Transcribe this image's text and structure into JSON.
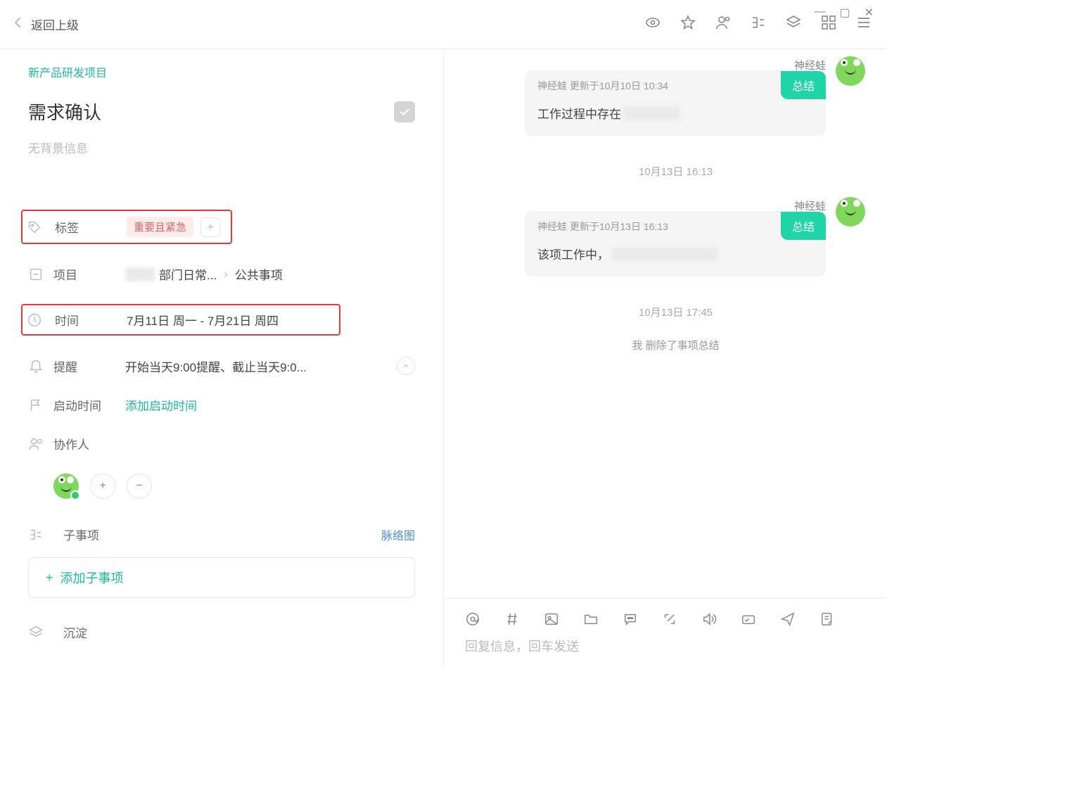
{
  "window": {
    "minimize": "—",
    "maximize": "▢",
    "close": "✕"
  },
  "topbar": {
    "back_label": "返回上级"
  },
  "breadcrumb": "新产品研发项目",
  "title": "需求确认",
  "subtitle_placeholder": "无背景信息",
  "fields": {
    "tags": {
      "label": "标签",
      "tag": "重要且紧急"
    },
    "project": {
      "label": "项目",
      "value_suffix": "部门日常...",
      "crumb": "公共事项"
    },
    "time": {
      "label": "时间",
      "value": "7月11日 周一 - 7月21日 周四"
    },
    "reminder": {
      "label": "提醒",
      "value": "开始当天9:00提醒、截止当天9:0..."
    },
    "start_time": {
      "label": "启动时间",
      "action": "添加启动时间"
    },
    "collaborators": {
      "label": "协作人"
    },
    "subitems": {
      "label": "子事项",
      "context_link": "脉络图",
      "add_label": "添加子事项"
    },
    "precipitate": {
      "label": "沉淀"
    }
  },
  "chat": {
    "messages": [
      {
        "sender": "神经蛙",
        "meta": "神经蛙 更新于10月10日 10:34",
        "tag": "总结",
        "body_prefix": "工作过程中存在"
      }
    ],
    "ts1": "10月13日 16:13",
    "messages2": [
      {
        "sender": "神经蛙",
        "meta": "神经蛙 更新于10月13日 16:13",
        "tag": "总结",
        "body_prefix": "该项工作中，"
      }
    ],
    "ts2": "10月13日 17:45",
    "sys_msg": "我 删除了事项总结"
  },
  "compose": {
    "placeholder": "回复信息，回车发送"
  }
}
